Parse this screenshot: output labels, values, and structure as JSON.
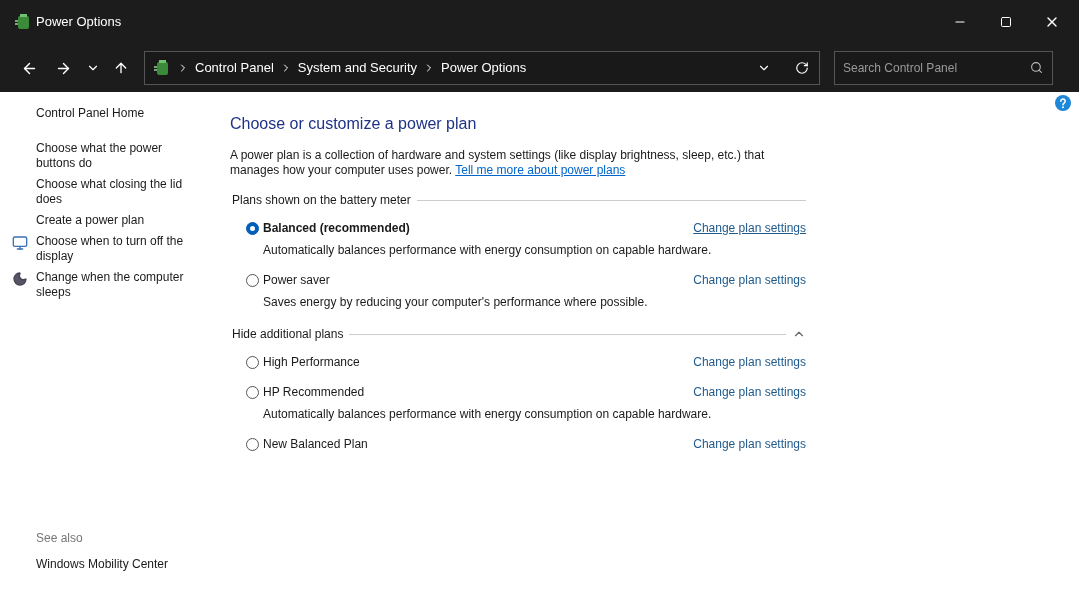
{
  "window": {
    "title": "Power Options"
  },
  "breadcrumb": [
    "Control Panel",
    "System and Security",
    "Power Options"
  ],
  "search": {
    "placeholder": "Search Control Panel"
  },
  "sidebar": {
    "items": [
      {
        "label": "Control Panel Home",
        "kind": "plain"
      },
      {
        "label": "Choose what the power buttons do",
        "kind": "plain"
      },
      {
        "label": "Choose what closing the lid does",
        "kind": "plain"
      },
      {
        "label": "Create a power plan",
        "kind": "plain"
      },
      {
        "label": "Choose when to turn off the display",
        "kind": "display"
      },
      {
        "label": "Change when the computer sleeps",
        "kind": "sleep"
      }
    ],
    "see_also": {
      "heading": "See also",
      "items": [
        "Windows Mobility Center"
      ]
    }
  },
  "main": {
    "title": "Choose or customize a power plan",
    "intro": "A power plan is a collection of hardware and system settings (like display brightness, sleep, etc.) that manages how your computer uses power.",
    "intro_link": "Tell me more about power plans",
    "sections": [
      {
        "heading": "Plans shown on the battery meter",
        "collapsible": false,
        "plans": [
          {
            "name": "Balanced (recommended)",
            "selected": true,
            "description": "Automatically balances performance with energy consumption on capable hardware.",
            "link": "Change plan settings"
          },
          {
            "name": "Power saver",
            "selected": false,
            "description": "Saves energy by reducing your computer's performance where possible.",
            "link": "Change plan settings"
          }
        ]
      },
      {
        "heading": "Hide additional plans",
        "collapsible": true,
        "plans": [
          {
            "name": "High Performance",
            "selected": false,
            "link": "Change plan settings"
          },
          {
            "name": "HP Recommended",
            "selected": false,
            "description": "Automatically balances performance with energy consumption on capable hardware.",
            "link": "Change plan settings"
          },
          {
            "name": "New Balanced Plan",
            "selected": false,
            "link": "Change plan settings"
          }
        ]
      }
    ]
  }
}
